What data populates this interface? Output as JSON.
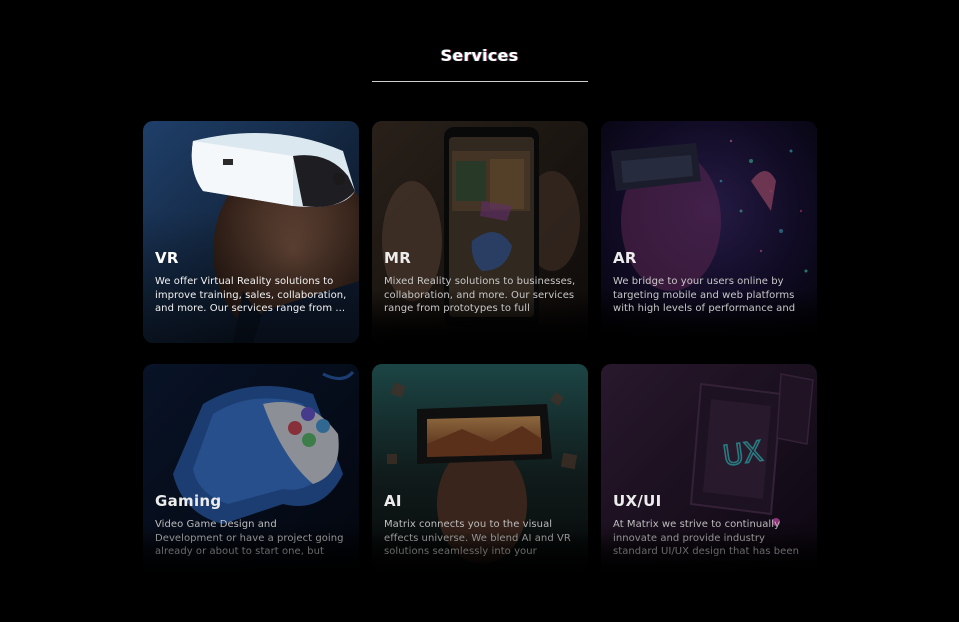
{
  "section": {
    "heading": "Services"
  },
  "cards": [
    {
      "id": "vr",
      "title": "VR",
      "description": "We offer Virtual Reality solutions to improve training, sales, collaboration, and more. Our services range from ...",
      "icon": "vr-headset-image"
    },
    {
      "id": "mr",
      "title": "MR",
      "description": "Mixed Reality solutions to businesses, collaboration, and more. Our services range from prototypes to full releases.",
      "icon": "phone-ar-image"
    },
    {
      "id": "ar",
      "title": "AR",
      "description": "We bridge to your users online by targeting mobile and web platforms with high levels of performance and ...",
      "icon": "vr-particles-image"
    },
    {
      "id": "gaming",
      "title": "Gaming",
      "description": "Video Game Design and Development or have a project going already or about to start one, but want to save time and ...",
      "icon": "game-controller-image"
    },
    {
      "id": "ai",
      "title": "AI",
      "description": "Matrix connects you to the visual effects universe. We blend AI and VR solutions seamlessly into your operations ...",
      "icon": "ai-goggles-image"
    },
    {
      "id": "uxui",
      "title": "UX/UI",
      "description": "At Matrix we strive to continually innovate and provide industry standard UI/UX design that has been used to ...",
      "icon": "ux-phone-image",
      "artwork_text": "UX"
    }
  ]
}
